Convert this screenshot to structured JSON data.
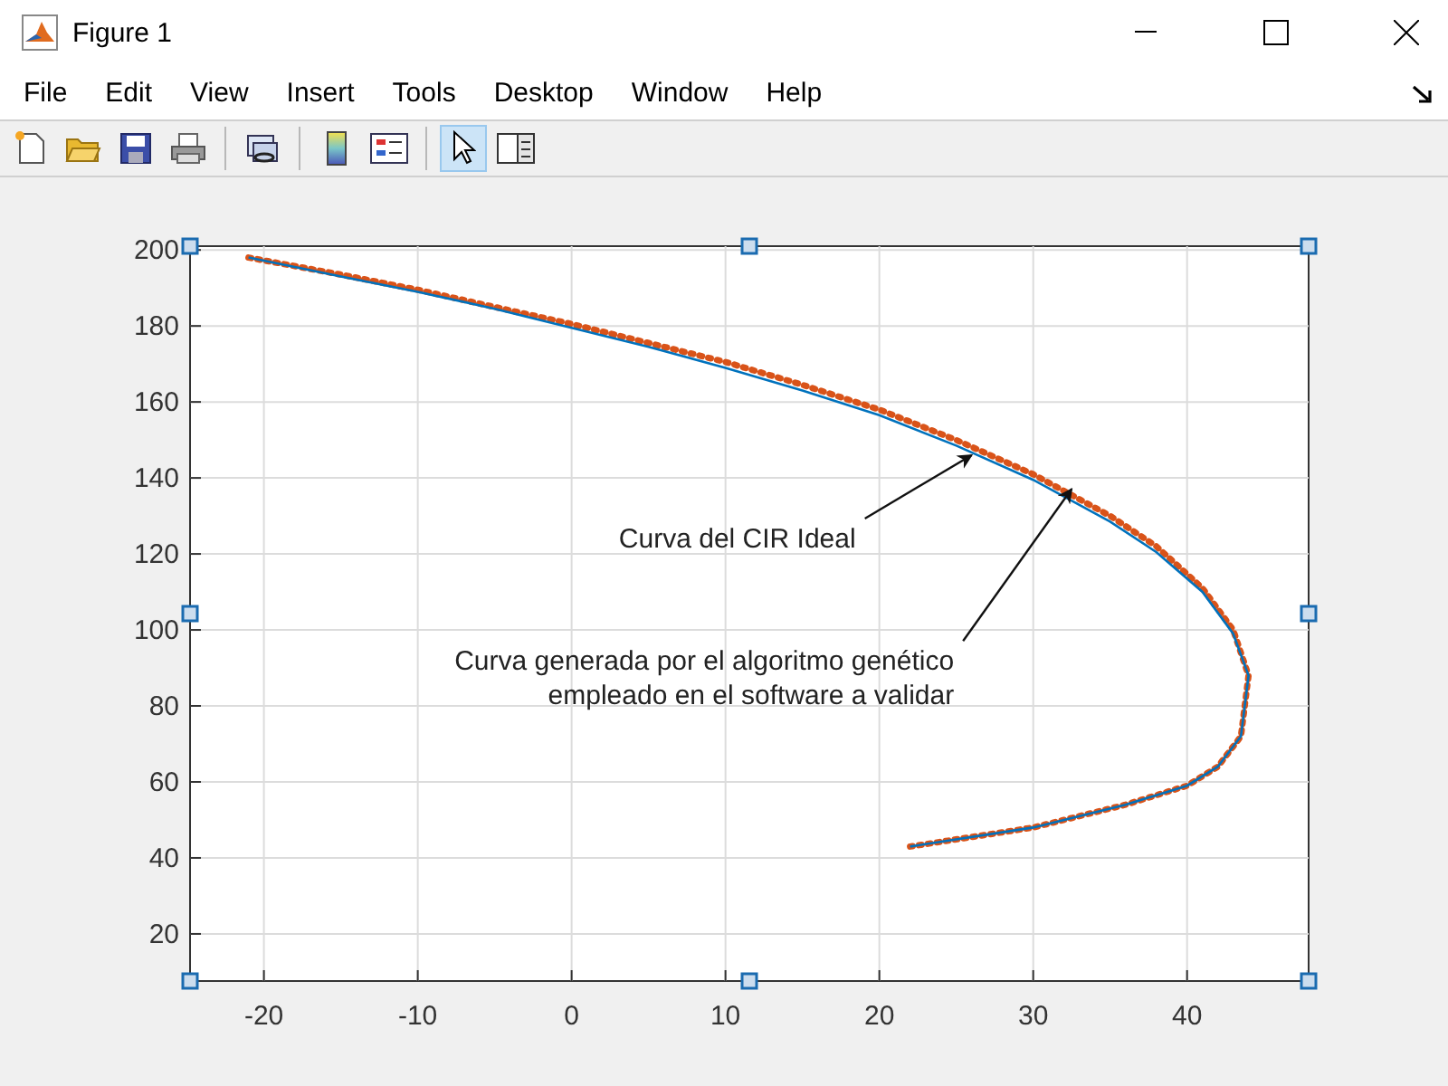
{
  "window": {
    "title": "Figure 1"
  },
  "menu": [
    "File",
    "Edit",
    "View",
    "Insert",
    "Tools",
    "Desktop",
    "Window",
    "Help"
  ],
  "toolbar": [
    {
      "kind": "new",
      "selected": false
    },
    {
      "kind": "open",
      "selected": false
    },
    {
      "kind": "save",
      "selected": false
    },
    {
      "kind": "print",
      "selected": false
    },
    {
      "kind": "link",
      "selected": false
    },
    {
      "kind": "colorbar",
      "selected": false
    },
    {
      "kind": "legend",
      "selected": false
    },
    {
      "kind": "pointer",
      "selected": true
    },
    {
      "kind": "inspector",
      "selected": false
    }
  ],
  "chart_data": {
    "type": "line",
    "x": [
      -21,
      -15,
      -10,
      -5,
      0,
      5,
      10,
      15,
      20,
      25,
      30,
      35,
      38,
      41,
      43,
      44,
      43.5,
      42,
      40,
      36,
      30,
      22
    ],
    "series": [
      {
        "color": "#0072bd",
        "line_style": "solid",
        "values": [
          198,
          193,
          189,
          184.5,
          179.5,
          174.5,
          169,
          163,
          156.5,
          148.5,
          139.5,
          128.5,
          120.5,
          110,
          99,
          88,
          72,
          64,
          59,
          54,
          48,
          43
        ]
      },
      {
        "color": "#d95319",
        "line_style": "dotted",
        "values": [
          198,
          193.5,
          189.5,
          185,
          180.5,
          175.5,
          170.5,
          164.5,
          158,
          150,
          141,
          130,
          122,
          111,
          100,
          88,
          72,
          64,
          59,
          54,
          48,
          43
        ]
      }
    ],
    "xlim": [
      -24.8,
      47.9
    ],
    "ylim": [
      7.6,
      201
    ],
    "grid": true,
    "xticks": [
      -20,
      -10,
      0,
      10,
      20,
      30,
      40
    ],
    "yticks": [
      20,
      40,
      60,
      80,
      100,
      120,
      140,
      160,
      180,
      200
    ],
    "annotations": [
      {
        "text": "Curva del CIR Ideal",
        "x": 26,
        "y": 146
      },
      {
        "text": "Curva generada por el algoritmo genético\nempleado en el software a validar",
        "x": 32.5,
        "y": 137.1
      }
    ]
  }
}
